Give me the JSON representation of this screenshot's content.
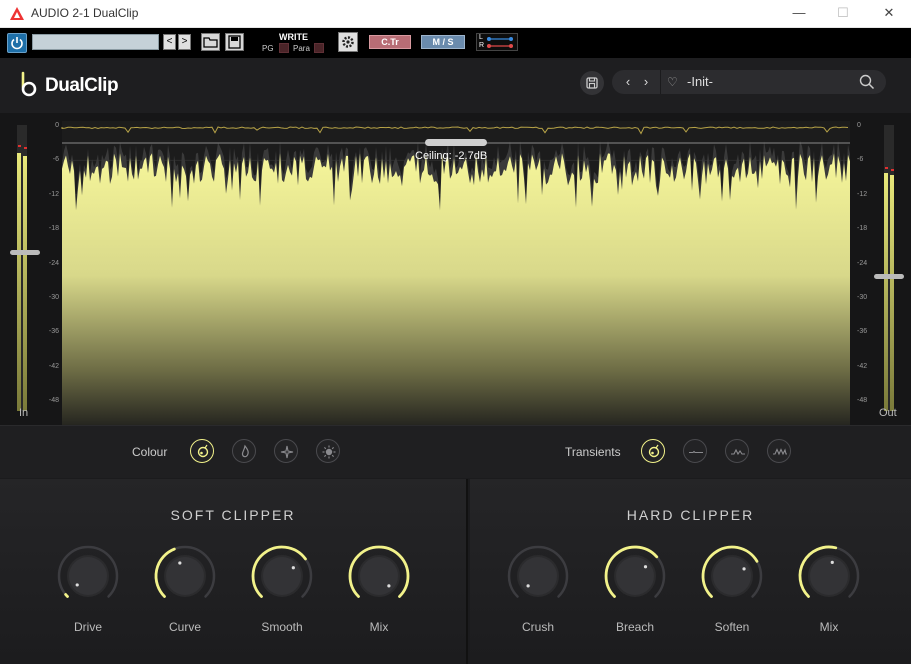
{
  "window": {
    "title": "AUDIO 2-1 DualClip",
    "minimize": "—",
    "maximize": "☐",
    "close": "✕"
  },
  "host": {
    "prev_label": "<",
    "next_label": ">",
    "write_label": "WRITE",
    "pg_label": "PG",
    "para_label": "Para",
    "ctr_label": "C.Tr",
    "ms_label": "M / S",
    "l_label": "L",
    "r_label": "R"
  },
  "plugin": {
    "brand": "DualClip",
    "preset_name": "-Init-",
    "nav_prev": "‹",
    "nav_next": "›"
  },
  "display": {
    "ceiling_label": "Ceiling: -2.7dB",
    "in_label": "In",
    "out_label": "Out",
    "scale": [
      "0",
      "-6",
      "-12",
      "-18",
      "-24",
      "-30",
      "-36",
      "-42",
      "-48"
    ],
    "accent_color": "#f2f28a"
  },
  "colour_row": {
    "label": "Colour",
    "modes": [
      "colour-mode-1-icon",
      "flame-icon",
      "sparkle-icon",
      "sun-icon"
    ],
    "active": 0
  },
  "transients_row": {
    "label": "Transients",
    "modes": [
      "transient-mode-1-icon",
      "transient-flat-icon",
      "transient-peaks-icon",
      "transient-multi-peaks-icon"
    ],
    "active": 0
  },
  "soft_clipper": {
    "title": "SOFT CLIPPER",
    "knobs": [
      {
        "label": "Drive",
        "value": 0.02
      },
      {
        "label": "Curve",
        "value": 0.42
      },
      {
        "label": "Smooth",
        "value": 0.7
      },
      {
        "label": "Mix",
        "value": 1.0
      }
    ]
  },
  "hard_clipper": {
    "title": "HARD CLIPPER",
    "knobs": [
      {
        "label": "Crush",
        "value": 0.0
      },
      {
        "label": "Breach",
        "value": 0.68
      },
      {
        "label": "Soften",
        "value": 0.72
      },
      {
        "label": "Mix",
        "value": 0.55
      }
    ]
  }
}
